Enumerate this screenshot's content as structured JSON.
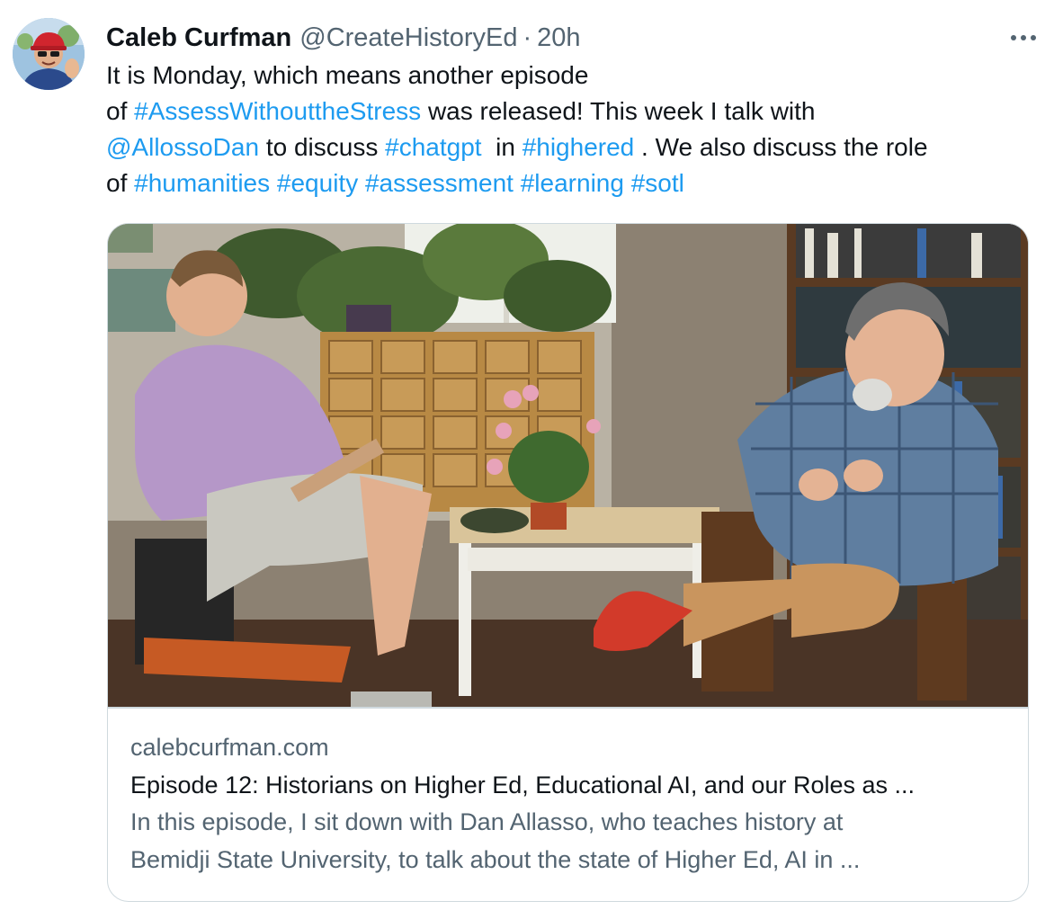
{
  "author": {
    "name": "Caleb Curfman",
    "handle": "@CreateHistoryEd",
    "separator": "·",
    "time": "20h"
  },
  "tweet": {
    "lines": [
      [
        {
          "t": "It is Monday, which means another episode",
          "link": false
        }
      ],
      [
        {
          "t": "of ",
          "link": false
        },
        {
          "t": "#AssessWithouttheStress",
          "link": true
        },
        {
          "t": " was released! This week I talk with",
          "link": false
        }
      ],
      [
        {
          "t": "@AllossoDan",
          "link": true
        },
        {
          "t": " to discuss ",
          "link": false
        },
        {
          "t": "#chatgpt",
          "link": true
        },
        {
          "t": "  in ",
          "link": false
        },
        {
          "t": "#highered",
          "link": true
        },
        {
          "t": " . We also discuss the role",
          "link": false
        }
      ],
      [
        {
          "t": "of ",
          "link": false
        },
        {
          "t": "#humanities",
          "link": true
        },
        {
          "t": " ",
          "link": false
        },
        {
          "t": "#equity",
          "link": true
        },
        {
          "t": " ",
          "link": false
        },
        {
          "t": "#assessment",
          "link": true
        },
        {
          "t": " ",
          "link": false
        },
        {
          "t": "#learning",
          "link": true
        },
        {
          "t": " ",
          "link": false
        },
        {
          "t": "#sotl",
          "link": true
        }
      ]
    ]
  },
  "card": {
    "domain": "calebcurfman.com",
    "title": "Episode 12: Historians on Higher Ed, Educational AI, and our Roles as ...",
    "description_lines": [
      "In this episode, I sit down with Dan Allasso, who teaches history at",
      "Bemidji State University, to talk about the state of Higher Ed, AI in ..."
    ]
  },
  "icons": {
    "more": "more-horizontal-icon"
  },
  "colors": {
    "text": "#0f1419",
    "secondary": "#536471",
    "link": "#1d9bf0",
    "border": "#cfd9de"
  }
}
